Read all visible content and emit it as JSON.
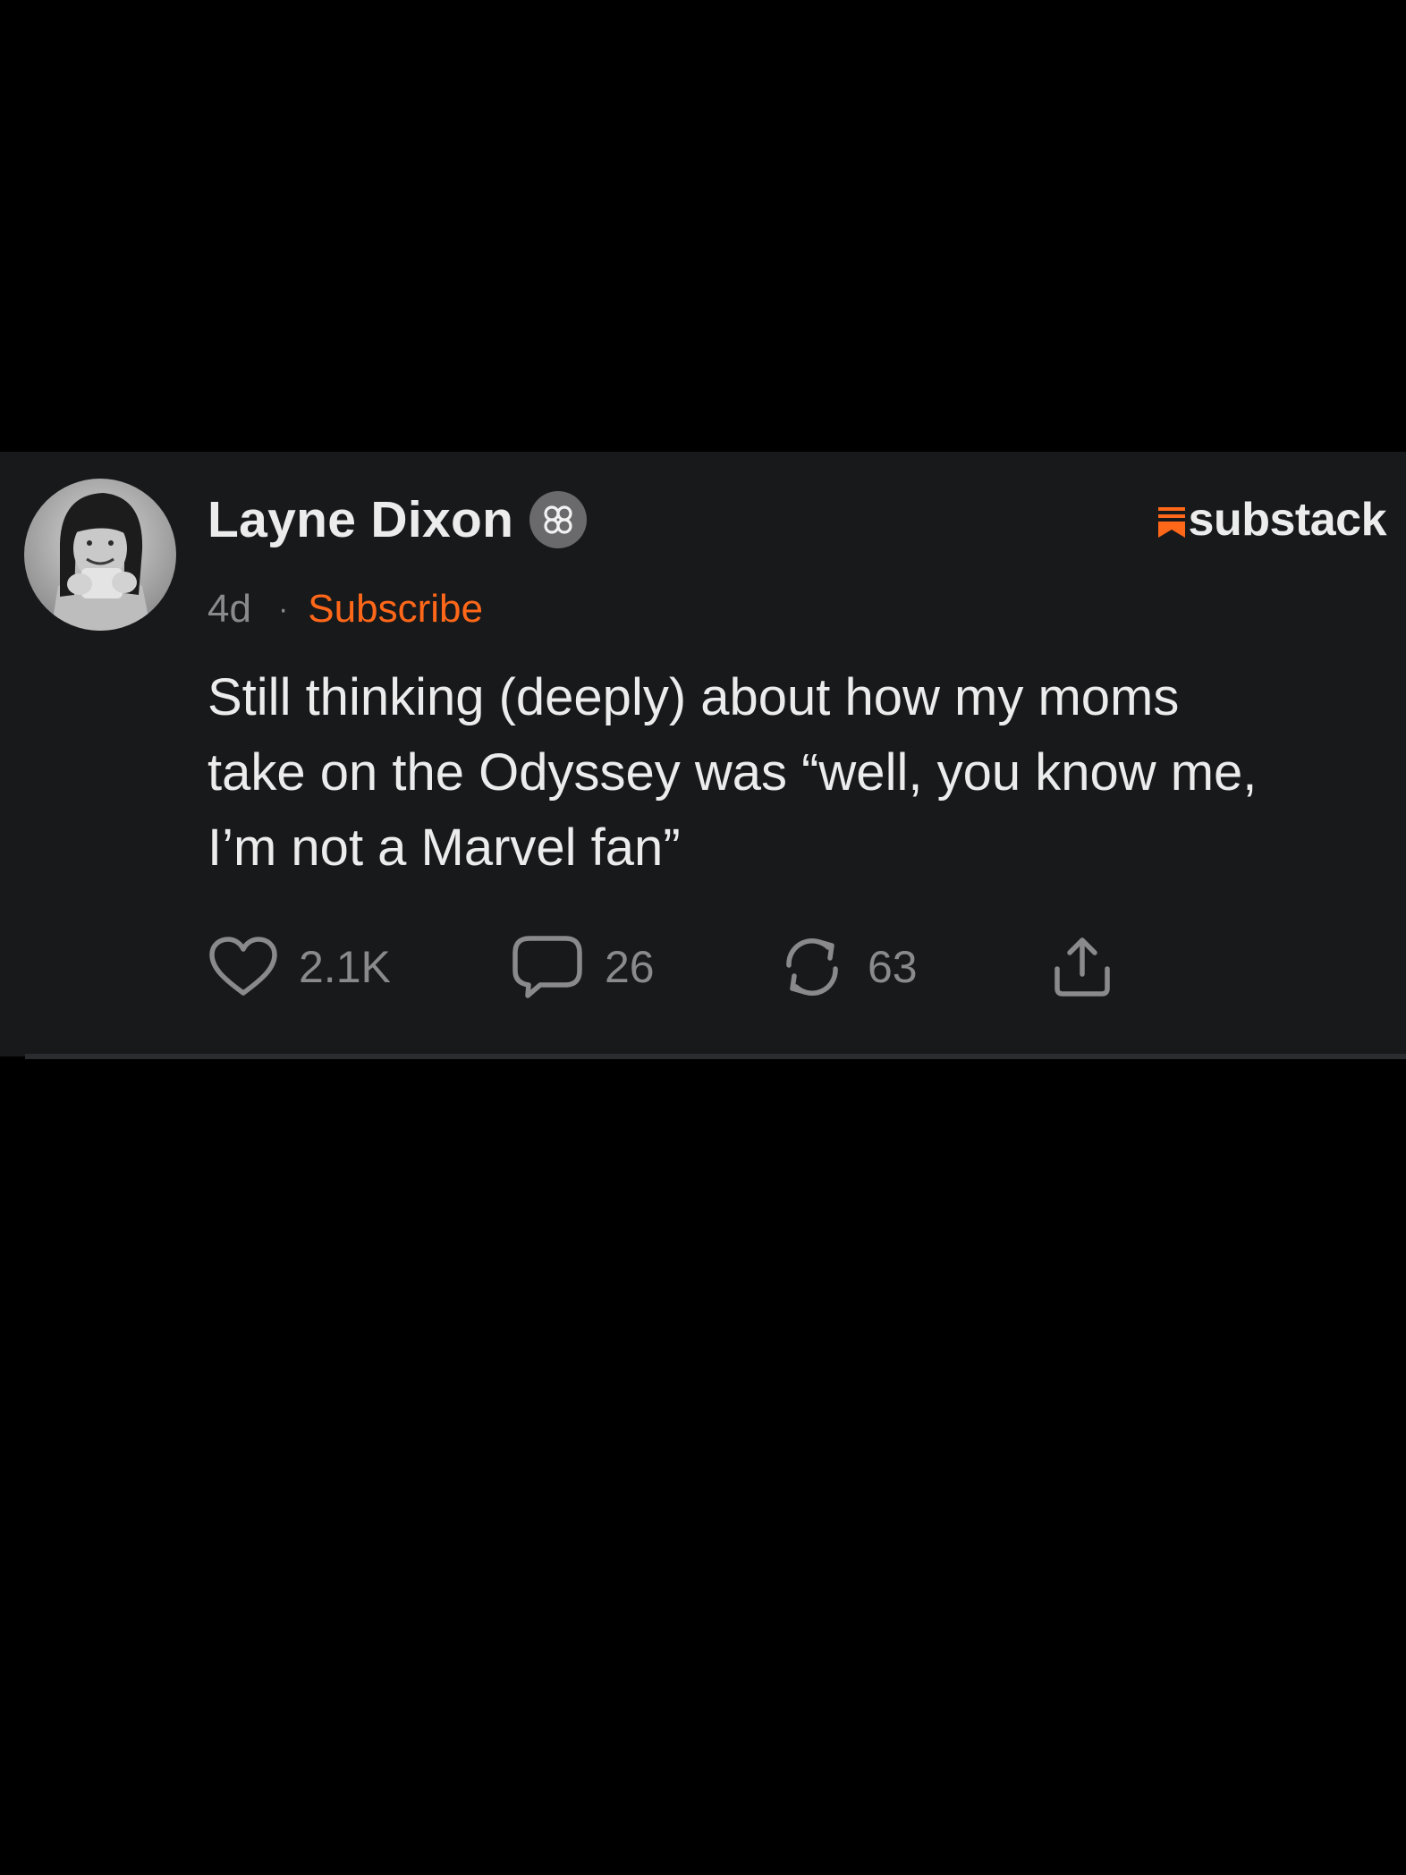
{
  "post": {
    "author_name": "Layne Dixon",
    "brand_name": "substack",
    "timestamp": "4d",
    "separator": "·",
    "subscribe_label": "Subscribe",
    "body_lines": [
      "Still thinking (deeply) about how my moms",
      "take on the Odyssey was “well, you know me,",
      "I’m not a Marvel fan”"
    ]
  },
  "actions": {
    "likes": "2.1K",
    "comments": "26",
    "restacks": "63"
  },
  "icons": {
    "verified_badge": "flower-badge-icon",
    "brand_mark": "substack-logo-icon",
    "like": "heart-icon",
    "comment": "comment-bubble-icon",
    "restack": "restack-arrows-icon",
    "share": "share-icon"
  },
  "colors": {
    "page_background": "#000000",
    "card_background": "#18191b",
    "primary_text": "#ececec",
    "secondary_text": "#8a8a8d",
    "accent": "#ff6719"
  }
}
